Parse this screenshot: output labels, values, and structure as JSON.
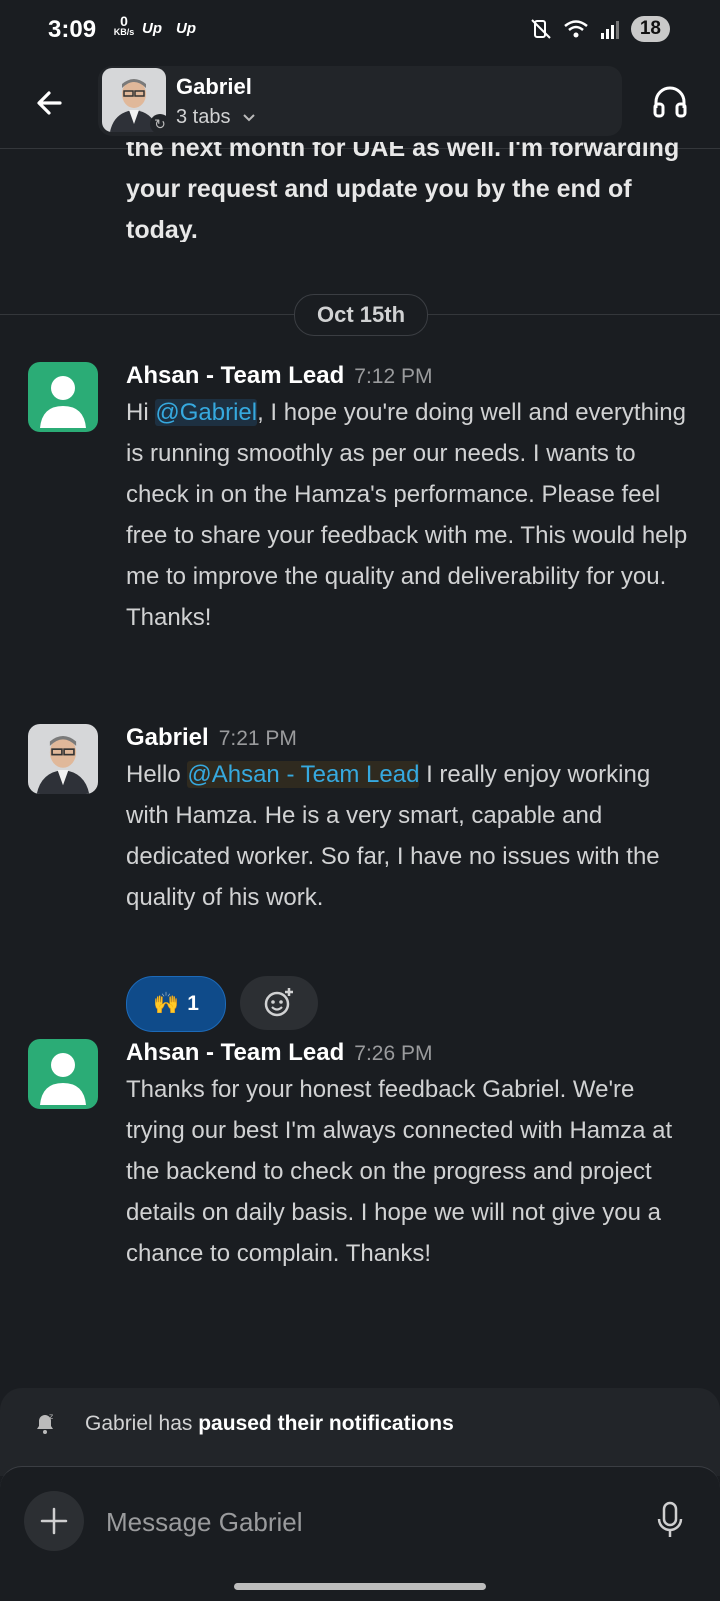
{
  "status_bar": {
    "time": "3:09",
    "net_speed": "0",
    "net_unit": "KB/s",
    "up1": "Up",
    "up2": "Up",
    "battery": "18"
  },
  "header": {
    "name": "Gabriel",
    "tabs": "3 tabs"
  },
  "previous_message_tail": "the next month for UAE as well. I'm forwarding your request and update you by the end of today.",
  "date_divider": "Oct 15th",
  "messages": [
    {
      "author": "Ahsan - Team Lead",
      "time": "7:12 PM",
      "pre": "Hi ",
      "mention": "@Gabriel",
      "text": ", I hope you're doing well and everything is running smoothly as per our needs. I wants to check in on the Hamza's performance. Please feel free to share your feedback with me. This would help me to improve the quality and deliverability for you. Thanks!"
    },
    {
      "author": "Gabriel",
      "time": "7:21 PM",
      "pre": "Hello ",
      "mention": "@Ahsan - Team Lead",
      "text": " I really enjoy working with Hamza.  He is a very smart, capable and dedicated worker.  So far, I have no issues with the quality of his work."
    },
    {
      "author": "Ahsan - Team Lead",
      "time": "7:26 PM",
      "text": "Thanks for your honest feedback Gabriel. We're trying our best I'm always connected with Hamza at the backend to check on the progress and project details on daily basis. I hope we will not give you a chance to complain. Thanks!"
    }
  ],
  "reaction": {
    "emoji": "🙌",
    "count": "1"
  },
  "notice": {
    "prefix": "Gabriel has ",
    "bold": "paused their notifications"
  },
  "composer": {
    "placeholder": "Message Gabriel"
  },
  "icons": {
    "back": "arrow-left-icon",
    "headphones": "headphones-icon",
    "add_reaction": "add-reaction-icon",
    "plus": "plus-icon",
    "mic": "microphone-icon",
    "notification_paused": "bell-snooze-icon"
  },
  "colors": {
    "background": "#1a1d21",
    "mention": "#36a9df",
    "reaction_active": "#0f4b8a",
    "avatar_green": "#2bac76"
  }
}
